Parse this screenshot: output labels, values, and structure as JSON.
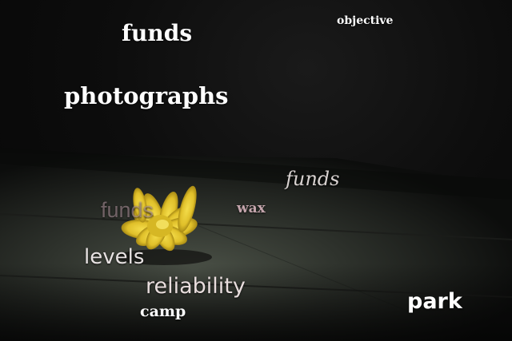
{
  "scene": {
    "background_color": "#0b0b0b",
    "table_color": "#3a3f38",
    "flower_color": "#e6c928"
  },
  "words": {
    "funds_top": "funds",
    "objective": "objective",
    "photographs": "photographs",
    "funds_script": "funds",
    "funds_faint": "funds",
    "wax": "wax",
    "levels": "levels",
    "reliability": "reliability",
    "camp": "camp",
    "park": "park"
  }
}
